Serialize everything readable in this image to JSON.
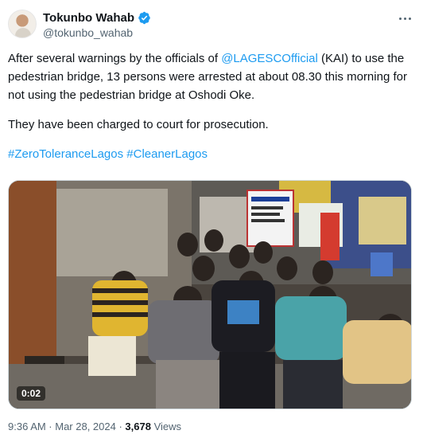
{
  "author": {
    "display_name": "Tokunbo Wahab",
    "handle": "@tokunbo_wahab",
    "avatar_icon": "profile-photo",
    "verified_color": "#1d9bf0"
  },
  "tweet": {
    "line1_before": "After several warnings by the officials of ",
    "mention": "@LAGESCOfficial",
    "line1_after": " (KAI) to use the pedestrian bridge, 13 persons were arrested at about 08.30 this morning for not using the pedestrian bridge at Oshodi Oke.",
    "paragraph2": "They have been charged to court for prosecution.",
    "hashtag1": "#ZeroToleranceLagos",
    "hashtag2": "#CleanerLagos"
  },
  "media": {
    "video_time": "0:02",
    "sign_text": "LAGESC"
  },
  "meta": {
    "time": "9:36 AM · Mar 28, 2024 · ",
    "views_count": "3,678",
    "views_label": " Views"
  },
  "colors": {
    "link": "#1d9bf0",
    "secondary_text": "#536471",
    "primary_text": "#0f1419"
  }
}
